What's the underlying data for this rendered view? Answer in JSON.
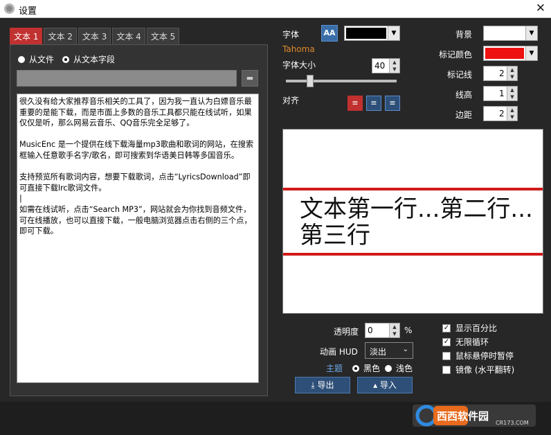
{
  "window": {
    "title": "设置",
    "close_glyph": "✕"
  },
  "tabs": [
    "文本 1",
    "文本 2",
    "文本 3",
    "文本 4",
    "文本 5"
  ],
  "source": {
    "from_file": "从文件",
    "from_text": "从文本字段",
    "selected": "from_text"
  },
  "browse_glyph": "▬",
  "text_content": [
    "很久没有给大家推荐音乐相关的工具了，因为我一直认为白嫖音乐最重要的是能下载，而是市面上多数的音乐工具都只能在线试听，如果仅仅是听，那么网易云音乐、QQ音乐完全足够了。",
    "MusicEnc 是一个提供在线下载海量mp3歌曲和歌词的网站，在搜索框输入任意歌手名字/歌名，即可搜索到华语美日韩等多国音乐。",
    "支持预览所有歌词内容，想要下载歌词，点击“LyricsDownload”即可直接下载lrc歌词文件。",
    "如需在线试听，点击“Search MP3”，网站就会为你找到音频文件，可在线播放，也可以直接下载，一般电脑浏览器点击右侧的三个点，即可下载。"
  ],
  "font": {
    "label": "字体",
    "button": "AA",
    "name": "Tahoma",
    "color": "#000000"
  },
  "font_size": {
    "label": "字体大小",
    "value": "40"
  },
  "align": {
    "label": "对齐",
    "options": [
      "≡",
      "≡",
      "≡"
    ],
    "selected": 0
  },
  "right_settings": {
    "background": {
      "label": "背景",
      "color": "#ffffff"
    },
    "marker_color": {
      "label": "标记颜色",
      "color": "#ee1111"
    },
    "marker_line": {
      "label": "标记线",
      "value": "2"
    },
    "line_height": {
      "label": "线高",
      "value": "1"
    },
    "margin": {
      "label": "边距",
      "value": "2"
    }
  },
  "preview": {
    "text": "文本第一行...第二行...第三行"
  },
  "transparency": {
    "label": "透明度",
    "value": "0",
    "unit": "%"
  },
  "animation": {
    "label": "动画 HUD",
    "value": "淡出"
  },
  "theme": {
    "label": "主题",
    "dark": "黑色",
    "light": "浅色",
    "selected": "dark"
  },
  "checks": [
    {
      "label": "显示百分比",
      "checked": true
    },
    {
      "label": "无限循环",
      "checked": true
    },
    {
      "label": "鼠标悬停时暂停",
      "checked": false
    },
    {
      "label": "镜像 (水平翻转)",
      "checked": false
    }
  ],
  "export_label": "导出",
  "import_label": "导入",
  "watermark": {
    "brand": "西西软件园",
    "url": "CR173.COM"
  }
}
